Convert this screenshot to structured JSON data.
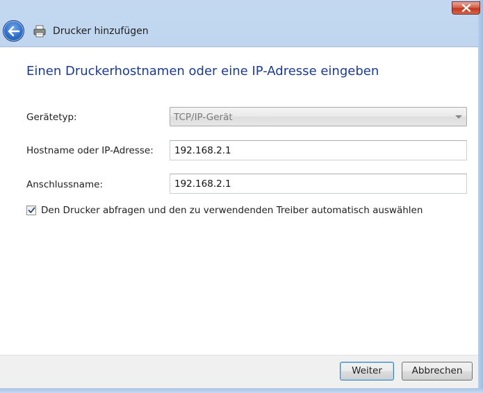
{
  "window": {
    "title": "Drucker hinzufügen"
  },
  "page": {
    "heading": "Einen Druckerhostnamen oder eine IP-Adresse eingeben"
  },
  "form": {
    "device_type": {
      "label": "Gerätetyp:",
      "value": "TCP/IP-Gerät"
    },
    "hostname": {
      "label": "Hostname oder IP-Adresse:",
      "value": "192.168.2.1"
    },
    "port_name": {
      "label": "Anschlussname:",
      "value": "192.168.2.1"
    },
    "auto_driver": {
      "label": "Den Drucker abfragen und den zu verwendenden Treiber automatisch auswählen",
      "checked": true
    }
  },
  "footer": {
    "next_label": "Weiter",
    "cancel_label": "Abbrechen"
  },
  "icons": {
    "close": "close-icon",
    "back": "back-arrow-icon",
    "printer": "printer-icon",
    "dropdown": "chevron-down-icon",
    "check": "checkmark-icon"
  },
  "colors": {
    "heading": "#1d3b8e",
    "close_button": "#c2381f",
    "back_button": "#2e6fc9"
  }
}
